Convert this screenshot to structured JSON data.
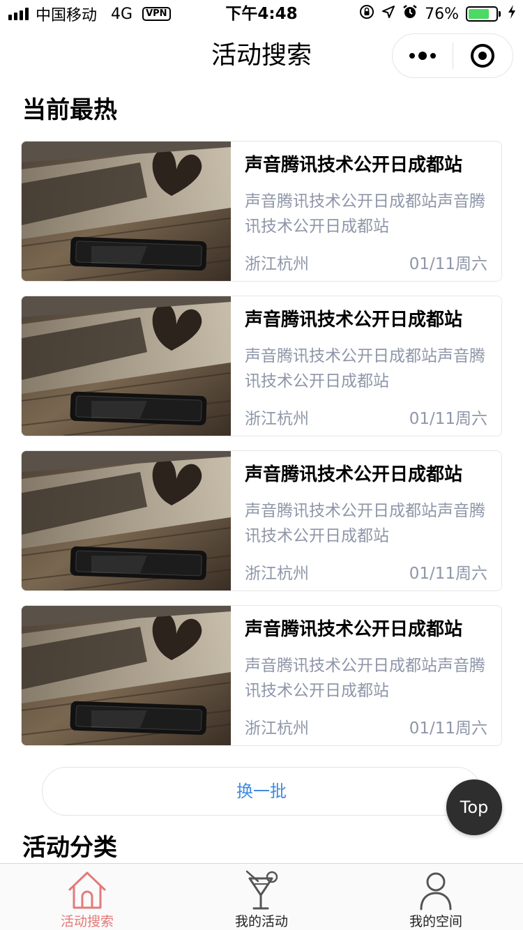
{
  "status_bar": {
    "carrier": "中国移动",
    "network": "4G",
    "vpn": "VPN",
    "time": "下午4:48",
    "battery_percent": "76%",
    "battery_level": 0.76,
    "battery_color": "#4cd964"
  },
  "nav": {
    "title": "活动搜索",
    "more_icon": "more-dots-icon",
    "close_icon": "target-close-icon"
  },
  "hot": {
    "title": "当前最热",
    "items": [
      {
        "title": "声音腾讯技术公开日成都站",
        "desc": "声音腾讯技术公开日成都站声音腾讯技术公开日成都站",
        "location": "浙江杭州",
        "date": "01/11周六"
      },
      {
        "title": "声音腾讯技术公开日成都站",
        "desc": "声音腾讯技术公开日成都站声音腾讯技术公开日成都站",
        "location": "浙江杭州",
        "date": "01/11周六"
      },
      {
        "title": "声音腾讯技术公开日成都站",
        "desc": "声音腾讯技术公开日成都站声音腾讯技术公开日成都站",
        "location": "浙江杭州",
        "date": "01/11周六"
      },
      {
        "title": "声音腾讯技术公开日成都站",
        "desc": "声音腾讯技术公开日成都站声音腾讯技术公开日成都站",
        "location": "浙江杭州",
        "date": "01/11周六"
      }
    ],
    "refresh_label": "换一批"
  },
  "top_button": "Top",
  "categories": {
    "title": "活动分类"
  },
  "tab_bar": {
    "tabs": [
      {
        "label": "活动搜索",
        "icon": "home-icon",
        "active": true
      },
      {
        "label": "我的活动",
        "icon": "cocktail-icon",
        "active": false
      },
      {
        "label": "我的空间",
        "icon": "user-icon",
        "active": false
      }
    ],
    "active_color": "#e27a7a"
  }
}
